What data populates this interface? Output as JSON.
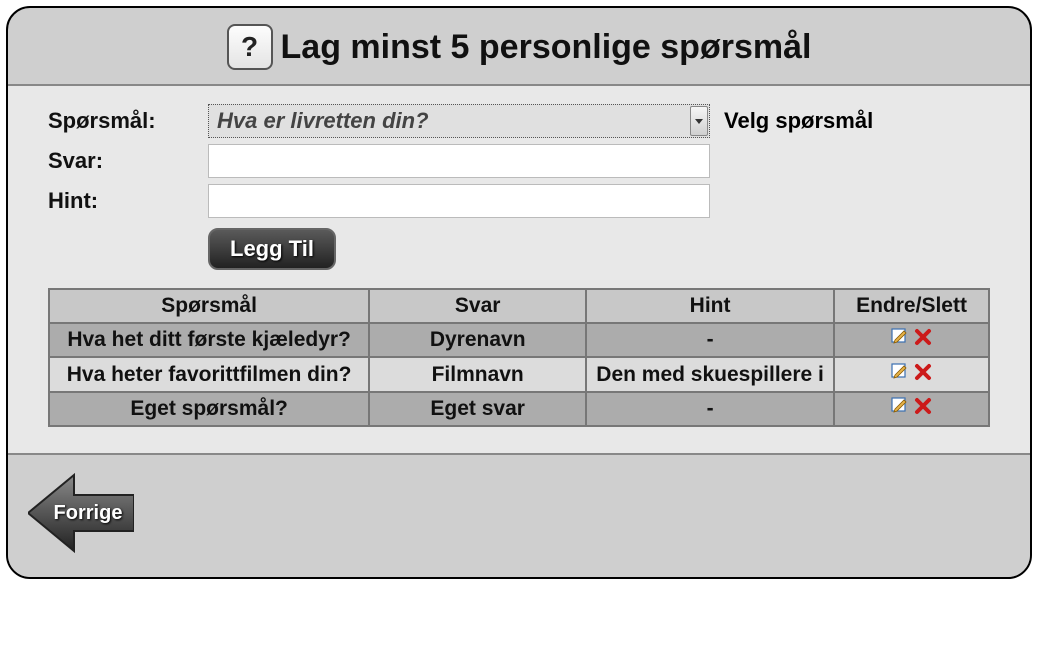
{
  "header": {
    "help_glyph": "?",
    "title": "Lag minst 5 personlige spørsmål"
  },
  "form": {
    "question_label": "Spørsmål:",
    "answer_label": "Svar:",
    "hint_label": "Hint:",
    "selected_question": "Hva er livretten din?",
    "right_label": "Velg spørsmål",
    "answer_value": "",
    "hint_value": "",
    "add_button": "Legg Til"
  },
  "table": {
    "headers": {
      "question": "Spørsmål",
      "answer": "Svar",
      "hint": "Hint",
      "edit_delete": "Endre/Slett"
    },
    "rows": [
      {
        "question": "Hva het ditt første kjæledyr?",
        "answer": "Dyrenavn",
        "hint": "-"
      },
      {
        "question": "Hva heter favorittfilmen din?",
        "answer": "Filmnavn",
        "hint": "Den med skuespillere i"
      },
      {
        "question": "Eget spørsmål?",
        "answer": "Eget svar",
        "hint": "-"
      }
    ]
  },
  "footer": {
    "back_label": "Forrige"
  }
}
